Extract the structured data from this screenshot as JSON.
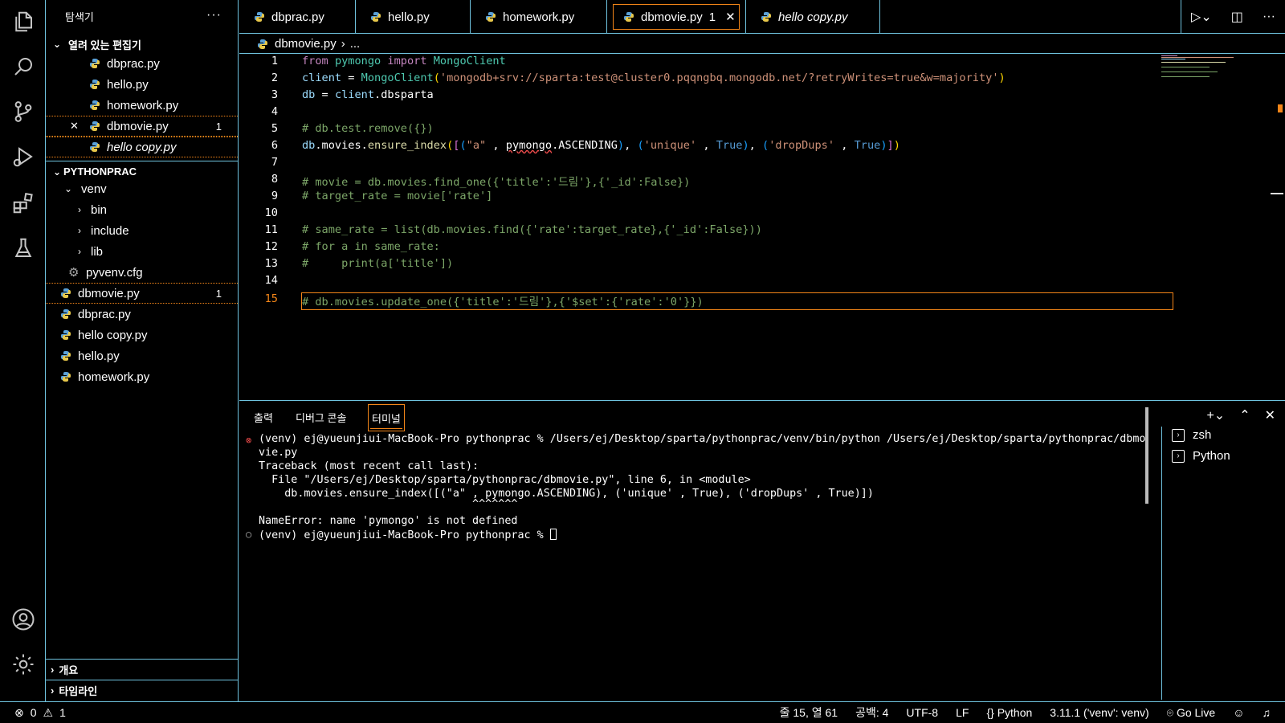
{
  "sidebar": {
    "title": "탐색기",
    "more": "···",
    "open_editors_label": "열려 있는 편집기",
    "open_editors": [
      {
        "name": "dbprac.py",
        "badge": "",
        "active": false,
        "italic": false
      },
      {
        "name": "hello.py",
        "badge": "",
        "active": false,
        "italic": false
      },
      {
        "name": "homework.py",
        "badge": "",
        "active": false,
        "italic": false
      },
      {
        "name": "dbmovie.py",
        "badge": "1",
        "active": true,
        "italic": false
      },
      {
        "name": "hello copy.py",
        "badge": "",
        "active": false,
        "italic": true
      }
    ],
    "project_label": "PYTHONPRAC",
    "venv_label": "venv",
    "venv_children": [
      "bin",
      "include",
      "lib"
    ],
    "cfg_file": "pyvenv.cfg",
    "files": [
      {
        "name": "dbmovie.py",
        "badge": "1"
      },
      {
        "name": "dbprac.py",
        "badge": ""
      },
      {
        "name": "hello copy.py",
        "badge": ""
      },
      {
        "name": "hello.py",
        "badge": ""
      },
      {
        "name": "homework.py",
        "badge": ""
      }
    ],
    "outline_label": "개요",
    "timeline_label": "타임라인"
  },
  "tabs": [
    {
      "label": "dbprac.py",
      "badge": "",
      "italic": false
    },
    {
      "label": "hello.py",
      "badge": "",
      "italic": false
    },
    {
      "label": "homework.py",
      "badge": "",
      "italic": false
    },
    {
      "label": "dbmovie.py",
      "badge": "1",
      "italic": false
    },
    {
      "label": "hello copy.py",
      "badge": "",
      "italic": true
    }
  ],
  "tab_close": "✕",
  "breadcrumb": {
    "file": "dbmovie.py",
    "sep": "›",
    "rest": "..."
  },
  "editor": {
    "line_numbers": [
      "1",
      "2",
      "3",
      "4",
      "5",
      "6",
      "7",
      "8",
      "9",
      "10",
      "11",
      "12",
      "13",
      "14",
      "15"
    ],
    "current_line": "15"
  },
  "panel": {
    "tabs": [
      "출력",
      "디버그 콘솔",
      "터미널"
    ],
    "active_tab": "터미널",
    "terminal_lines": [
      "(venv) ej@yueunjiui-MacBook-Pro pythonprac % /Users/ej/Desktop/sparta/pythonprac/venv/bin/python /Users/ej/Desktop/sparta/pythonprac/dbmo",
      "vie.py",
      "Traceback (most recent call last):",
      "  File \"/Users/ej/Desktop/sparta/pythonprac/dbmovie.py\", line 6, in <module>",
      "    db.movies.ensure_index([(\"a\" , pymongo.ASCENDING), ('unique' , True), ('dropDups' , True)])",
      "                                 ^^^^^^^",
      "",
      "NameError: name 'pymongo' is not defined",
      "(venv) ej@yueunjiui-MacBook-Pro pythonprac % "
    ],
    "terminals": [
      "zsh",
      "Python"
    ]
  },
  "status": {
    "errors": "0",
    "warnings": "1",
    "position": "줄 15, 열 61",
    "spaces": "공백: 4",
    "encoding": "UTF-8",
    "eol": "LF",
    "language": "Python",
    "interpreter": "3.11.1 ('venv': venv)",
    "golive": "Go Live"
  },
  "colors": {
    "accent": "#f38518",
    "border": "#6fc3df"
  }
}
